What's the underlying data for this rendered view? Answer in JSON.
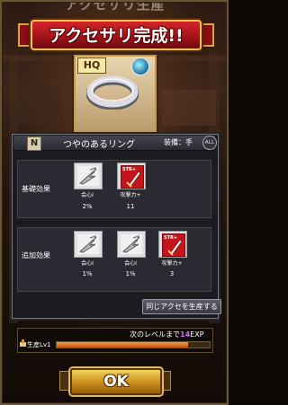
{
  "header": {
    "title_behind": "アクセサリ生産",
    "title": "アクセサリ完成!!"
  },
  "item": {
    "quality_badge": "HQ",
    "rank": "N",
    "name": "つやのあるリング",
    "equip_slot": "装備：手",
    "corner_badge": "ALL",
    "image_icon": "silver-ring-icon",
    "element_icon": "water-gem-icon"
  },
  "base_effects": {
    "label": "基礎効果",
    "items": [
      {
        "icon": "critical-slash-icon",
        "caption": "会心Ⅰ",
        "value": "2%"
      },
      {
        "icon": "str-up-icon",
        "tag": "STR+",
        "caption": "攻撃力+",
        "value": "11"
      }
    ]
  },
  "extra_effects": {
    "label": "追加効果",
    "items": [
      {
        "icon": "critical-slash-icon",
        "caption": "会心Ⅰ",
        "value": "1%"
      },
      {
        "icon": "critical-slash-icon",
        "caption": "会心Ⅰ",
        "value": "1%"
      },
      {
        "icon": "str-up-icon",
        "tag": "STR+",
        "caption": "攻撃力+",
        "value": "3"
      }
    ]
  },
  "actions": {
    "craft_same": "同じアクセを生産する",
    "ok": "OK"
  },
  "level": {
    "next_prefix": "次のレベルまで",
    "next_value": "14",
    "next_suffix": "EXP",
    "label": "生産Lv1",
    "progress_fraction": 0.86
  },
  "colors": {
    "banner_red": "#c41d24",
    "exp_highlight": "#d467ff",
    "ok_gold": "#e0b23a"
  }
}
